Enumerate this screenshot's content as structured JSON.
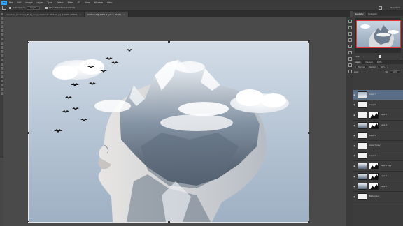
{
  "app": {
    "logo": "Ps",
    "menu": [
      "File",
      "Edit",
      "Image",
      "Layer",
      "Type",
      "Select",
      "Filter",
      "3D",
      "View",
      "Window",
      "Help"
    ]
  },
  "options": {
    "auto_select_label": "Auto-Select:",
    "auto_select_value": "Layer",
    "show_transform_label": "Show Transform Controls",
    "workspace": "Essentials"
  },
  "tabs": [
    {
      "label": "mountain_landscape_BY_by_Sergeydoshenko-d7hz3wl.jpg @ 100% (RGB/8)",
      "close": "×"
    },
    {
      "label": "Untitled-1 @ 100% (Layer 7, RGB/8)",
      "close": "×"
    }
  ],
  "panels": {
    "tabs": [
      "Navigator",
      "Histogram"
    ],
    "zoom": "100%",
    "layer_tabs": [
      "Layers",
      "Channels",
      "Paths"
    ],
    "blend_mode": "Normal",
    "opacity_label": "Opacity:",
    "opacity": "100%",
    "lock_label": "Lock:",
    "fill_label": "Fill:",
    "fill": "100%",
    "layers": [
      {
        "name": "Layer 7",
        "selected": true,
        "has_mask": false,
        "thumb": "clouds"
      },
      {
        "name": "Layer 6",
        "selected": false,
        "has_mask": false,
        "thumb": "white"
      },
      {
        "name": "Layer 5",
        "selected": false,
        "has_mask": true,
        "thumb": "white",
        "fx": ""
      },
      {
        "name": "Layer 4",
        "selected": false,
        "has_mask": true,
        "thumb": "mountain",
        "fx": ""
      },
      {
        "name": "Layer 3",
        "selected": false,
        "has_mask": false,
        "thumb": "white"
      },
      {
        "name": "Layer 3 copy",
        "selected": false,
        "has_mask": false,
        "thumb": "white"
      },
      {
        "name": "Layer 2",
        "selected": false,
        "has_mask": false,
        "thumb": "white"
      },
      {
        "name": "Layer 1 copy",
        "selected": false,
        "has_mask": true,
        "thumb": "mountain"
      },
      {
        "name": "Layer 1",
        "selected": false,
        "has_mask": true,
        "thumb": "mountain"
      },
      {
        "name": "Layer 0",
        "selected": false,
        "has_mask": true,
        "thumb": "mountain"
      },
      {
        "name": "Background",
        "selected": false,
        "has_mask": false,
        "thumb": "white"
      }
    ]
  },
  "colors": {
    "accent": "#31a8ff",
    "selection": "#5a6d86",
    "nav_frame": "#e0383b"
  }
}
